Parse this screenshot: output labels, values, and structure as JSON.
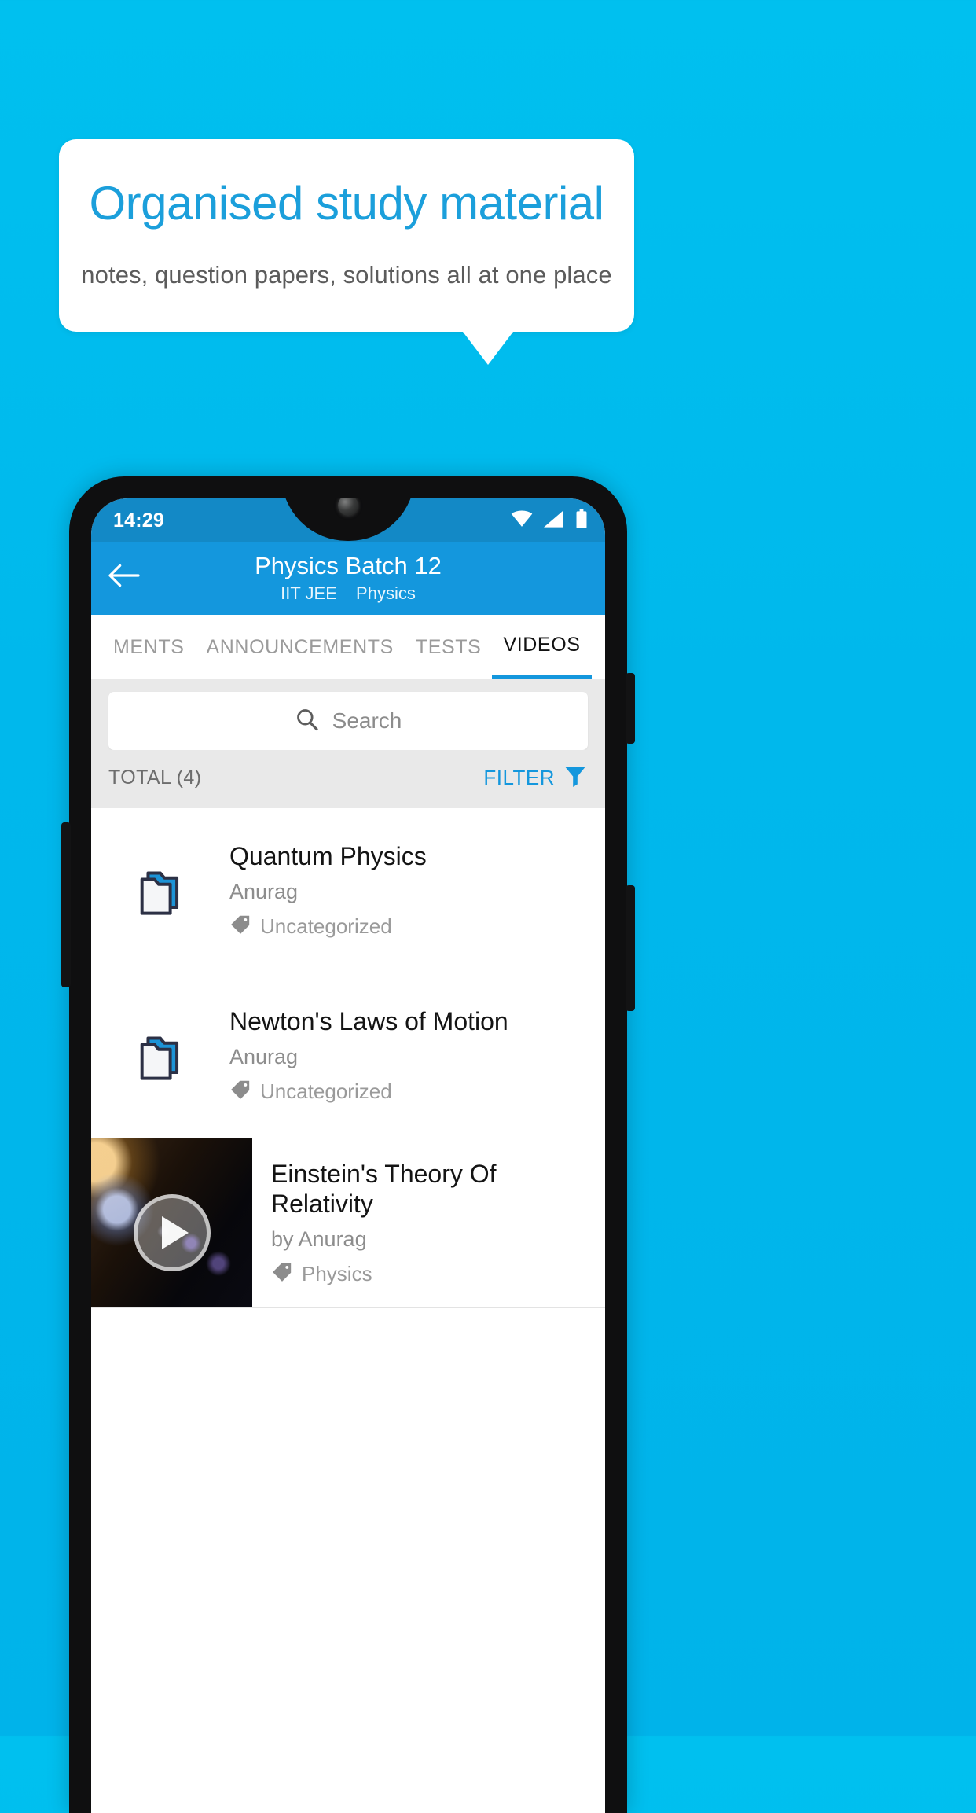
{
  "promo": {
    "title": "Organised study material",
    "subtitle": "notes, question papers, solutions all at one place",
    "accent_color": "#1b9fdb",
    "background_color": "#00b8ec"
  },
  "phone": {
    "status_bar": {
      "time": "14:29",
      "icons": [
        "wifi-icon",
        "signal-icon",
        "battery-icon"
      ],
      "background_color": "#1389c6"
    },
    "app_bar": {
      "back_icon": "arrow-left-icon",
      "title": "Physics Batch 12",
      "subtitle_exam": "IIT JEE",
      "subtitle_subject": "Physics",
      "background_color": "#1497dd"
    },
    "tabs": [
      {
        "label": "MENTS",
        "active": false
      },
      {
        "label": "ANNOUNCEMENTS",
        "active": false
      },
      {
        "label": "TESTS",
        "active": false
      },
      {
        "label": "VIDEOS",
        "active": true
      }
    ],
    "search": {
      "icon": "search-icon",
      "placeholder": "Search",
      "value": ""
    },
    "toolbar": {
      "total_label": "TOTAL (4)",
      "filter_label": "FILTER",
      "filter_icon": "funnel-icon",
      "filter_color": "#1497dd"
    },
    "list": [
      {
        "type": "folder",
        "icon": "folder-icon",
        "title": "Quantum Physics",
        "author": "Anurag",
        "tag_icon": "tag-icon",
        "tag": "Uncategorized"
      },
      {
        "type": "folder",
        "icon": "folder-icon",
        "title": "Newton's Laws of Motion",
        "author": "Anurag",
        "tag_icon": "tag-icon",
        "tag": "Uncategorized"
      },
      {
        "type": "video",
        "icon": "play-icon",
        "title": "Einstein's Theory Of Relativity",
        "author": "by Anurag",
        "tag_icon": "tag-icon",
        "tag": "Physics"
      }
    ]
  }
}
